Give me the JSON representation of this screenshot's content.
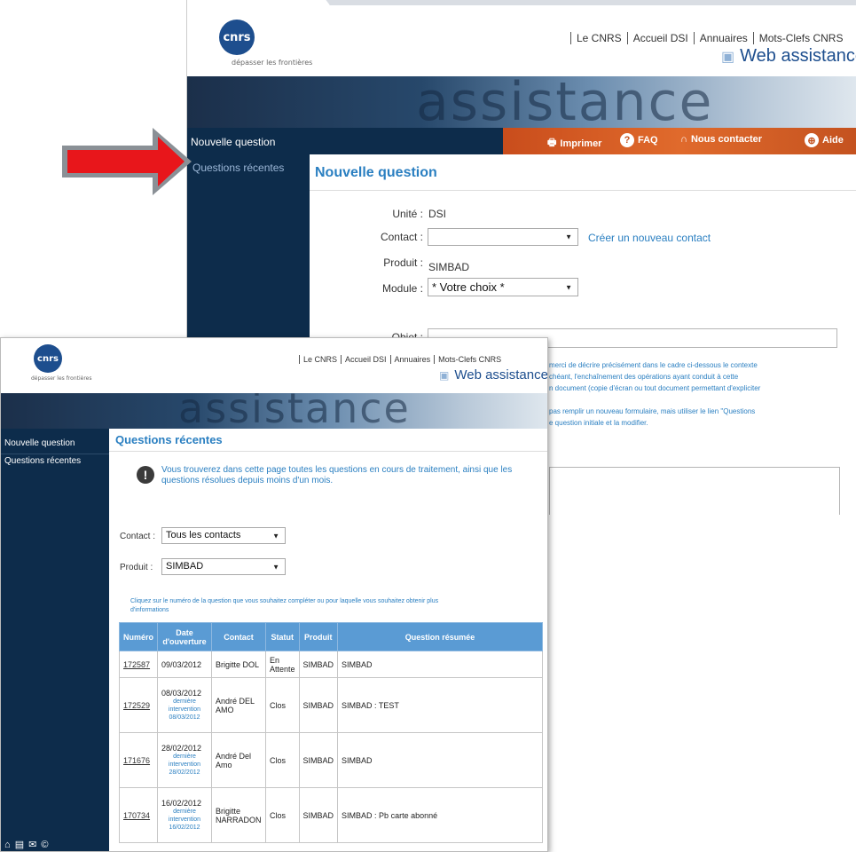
{
  "header": {
    "logo_text": "cnrs",
    "logo_tagline": "dépasser les frontières",
    "top_links": [
      "Le CNRS",
      "Accueil DSI",
      "Annuaires",
      "Mots-Clefs CNRS"
    ],
    "web_assistance": "Web assistance",
    "banner_word": "assistance"
  },
  "back_window": {
    "nav_tools": {
      "print": "Imprimer",
      "faq": "FAQ",
      "contact": "Nous contacter",
      "help": "Aide"
    },
    "sidebar": {
      "new_question": "Nouvelle question",
      "recent_questions": "Questions récentes"
    },
    "page_title": "Nouvelle question",
    "form": {
      "unit_label": "Unité :",
      "unit_value": "DSI",
      "contact_label": "Contact :",
      "contact_value": "",
      "create_contact_link": "Créer un nouveau contact",
      "product_label": "Produit :",
      "product_value": "SIMBAD",
      "module_label": "Module :",
      "module_value": "* Votre choix *",
      "object_label": "Objet :"
    },
    "help_lines": [
      "merci de décrire précisément dans le cadre ci-dessous le contexte",
      "chéant, l'enchaînement des opérations ayant conduit à cette",
      "n document (copie d'écran ou tout document permettant d'expliciter",
      "",
      "pas remplir un nouveau formulaire, mais utiliser le lien \"Questions",
      "e question initiale et la modifier."
    ]
  },
  "front_window": {
    "sidebar": {
      "new_question": "Nouvelle question",
      "recent_questions": "Questions récentes"
    },
    "page_title": "Questions récentes",
    "info_line1": "Vous trouverez dans cette page toutes les questions en cours de traitement, ainsi que les",
    "info_line2": "questions résolues depuis moins d'un mois.",
    "contact_label": "Contact :",
    "contact_value": "Tous les contacts",
    "product_label": "Produit :",
    "product_value": "SIMBAD",
    "note_line1": "Cliquez sur le numéro de la question que vous souhaitez compléter ou pour laquelle vous souhaitez obtenir plus",
    "note_line2": "d'informations",
    "table": {
      "headers": [
        "Numéro",
        "Date d'ouverture",
        "Contact",
        "Statut",
        "Produit",
        "Question résumée"
      ],
      "rows": [
        {
          "num": "172587",
          "date": "09/03/2012",
          "sub1": "",
          "sub2": "",
          "sub3": "",
          "contact": "Brigitte DOL",
          "status": "En Attente",
          "product": "SIMBAD",
          "summary": "SIMBAD"
        },
        {
          "num": "172529",
          "date": "08/03/2012",
          "sub1": "dernière",
          "sub2": "intervention",
          "sub3": "08/03/2012",
          "contact": "André DEL AMO",
          "status": "Clos",
          "product": "SIMBAD",
          "summary": "SIMBAD : TEST"
        },
        {
          "num": "171676",
          "date": "28/02/2012",
          "sub1": "dernière",
          "sub2": "intervention",
          "sub3": "28/02/2012",
          "contact": "André Del Amo",
          "status": "Clos",
          "product": "SIMBAD",
          "summary": "SIMBAD"
        },
        {
          "num": "170734",
          "date": "16/02/2012",
          "sub1": "dernière",
          "sub2": "intervention",
          "sub3": "16/02/2012",
          "contact": "Brigitte NARRADON",
          "status": "Clos",
          "product": "SIMBAD",
          "summary": "SIMBAD : Pb carte abonné"
        }
      ]
    },
    "bottom_icons": "⌂ ▤ ✉ ©"
  },
  "colors": {
    "navy": "#0d2c4b",
    "blue_link": "#2a7fc1",
    "table_header": "#5a9bd4",
    "orange_bar": "#d85e26",
    "arrow_red": "#e8161b",
    "arrow_border": "#8a9096"
  }
}
